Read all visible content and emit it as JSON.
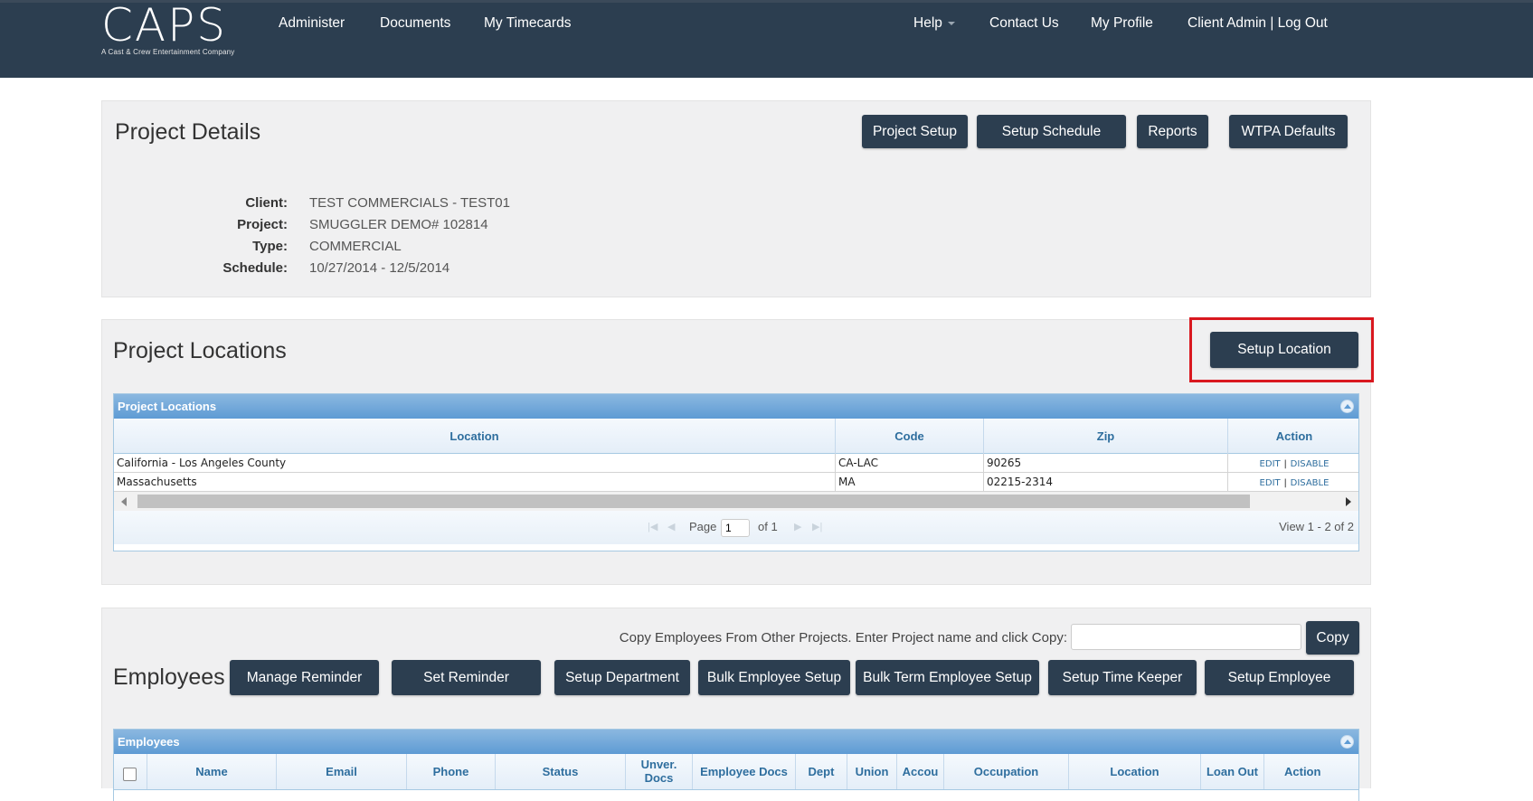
{
  "app": {
    "logo_text": "CAPS",
    "logo_tagline": "A Cast & Crew Entertainment Company"
  },
  "nav": {
    "left": [
      "Administer",
      "Documents",
      "My Timecards"
    ],
    "help": "Help",
    "contact": "Contact Us",
    "profile": "My Profile",
    "account": "Client Admin | Log Out"
  },
  "project_details": {
    "title": "Project Details",
    "buttons": [
      "Project Setup",
      "Setup Schedule",
      "Reports",
      "WTPA Defaults"
    ],
    "fields": [
      {
        "label": "Client:",
        "value": "TEST COMMERCIALS - TEST01"
      },
      {
        "label": "Project:",
        "value": "SMUGGLER DEMO# 102814"
      },
      {
        "label": "Type:",
        "value": "COMMERCIAL"
      },
      {
        "label": "Schedule:",
        "value": "10/27/2014 - 12/5/2014"
      }
    ]
  },
  "project_locations": {
    "title": "Project Locations",
    "setup_button": "Setup Location",
    "grid_caption": "Project Locations",
    "columns": [
      "Location",
      "Code",
      "Zip",
      "Action"
    ],
    "rows": [
      {
        "location": "California - Los Angeles County",
        "code": "CA-LAC",
        "zip": "90265",
        "edit": "EDIT",
        "sep": "|",
        "disable": "DISABLE"
      },
      {
        "location": "Massachusetts",
        "code": "MA",
        "zip": "02215-2314",
        "edit": "EDIT",
        "sep": "|",
        "disable": "DISABLE"
      }
    ],
    "pager": {
      "page_label": "Page",
      "page_value": "1",
      "of_label": "of 1",
      "view_text": "View 1 - 2 of 2"
    }
  },
  "employees": {
    "title": "Employees",
    "copy_prompt": "Copy Employees From Other Projects. Enter Project name and click Copy:",
    "copy_input_value": "",
    "copy_button": "Copy",
    "buttons": [
      "Manage Reminder",
      "Set Reminder",
      "Setup Department",
      "Bulk Employee Setup",
      "Bulk Term Employee Setup",
      "Setup Time Keeper",
      "Setup Employee"
    ],
    "grid_caption": "Employees",
    "columns": [
      "Name",
      "Email",
      "Phone",
      "Status",
      "Unver. Docs",
      "Employee Docs",
      "Dept",
      "Union",
      "Accou",
      "Occupation",
      "Location",
      "Loan Out",
      "Action"
    ]
  },
  "colors": {
    "navbar": "#2c3e50",
    "button": "#2c3e50",
    "panel": "#f0f0f1",
    "grid_header_text": "#2e6e9e",
    "highlight": "#d9181f"
  }
}
